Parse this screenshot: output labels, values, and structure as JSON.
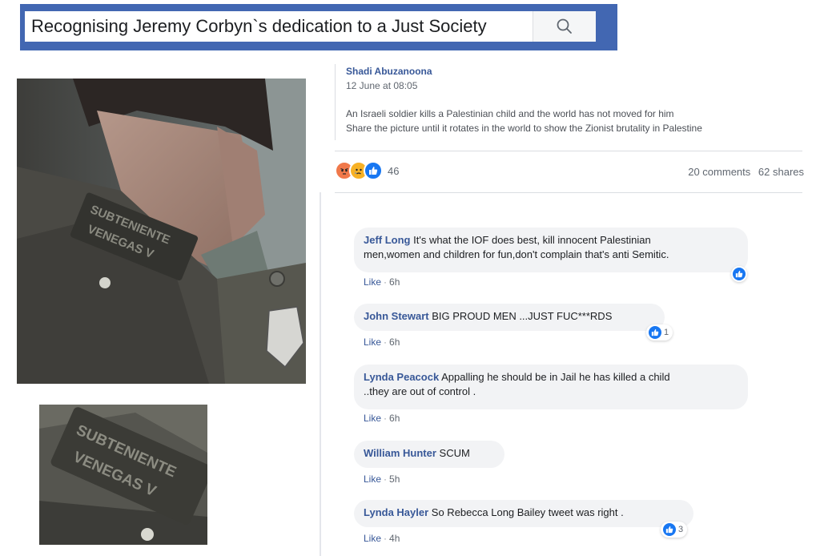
{
  "search": {
    "query": "Recognising Jeremy Corbyn`s dedication to a Just Society",
    "icon": "search-icon"
  },
  "post": {
    "author": "Shadi Abuzanoona",
    "time": "12 June at 08:05",
    "text_line1": "An Israeli soldier kills a Palestinian child and the world has not moved for him",
    "text_line2": "Share the picture until it rotates in the world to show the Zionist brutality in Palestine",
    "reaction_icons": [
      "angry-icon",
      "sad-icon",
      "like-icon"
    ],
    "reaction_count": "46",
    "comments_count": "20 comments",
    "shares_count": "62 shares"
  },
  "comments": [
    {
      "name": "Jeff Long",
      "text1": "It's what the IOF does best, kill innocent Palestinian",
      "text2": "men,women and children for fun,don't complain that's anti Semitic.",
      "like": "Like",
      "age": "6h",
      "likes": ""
    },
    {
      "name": "John Stewart",
      "text1": "BIG PROUD MEN ...JUST FUC***RDS",
      "text2": "",
      "like": "Like",
      "age": "6h",
      "likes": "1"
    },
    {
      "name": "Lynda Peacock",
      "text1": "Appalling he should be in Jail he has killed a child",
      "text2": "..they are out of control .",
      "like": "Like",
      "age": "6h",
      "likes": ""
    },
    {
      "name": "William Hunter",
      "text1": "SCUM",
      "text2": "",
      "like": "Like",
      "age": "5h",
      "likes": ""
    },
    {
      "name": "Lynda Hayler",
      "text1": "So Rebecca Long Bailey tweet was right .",
      "text2": "",
      "like": "Like",
      "age": "4h",
      "likes": "3"
    }
  ],
  "photo": {
    "badge_line1": "SUBTENIENTE",
    "badge_line2": "VENEGAS V"
  },
  "colors": {
    "header": "#4267b2",
    "link": "#385898",
    "like_blue": "#1877f2",
    "angry": "#f0784a",
    "sad": "#f7b125"
  }
}
